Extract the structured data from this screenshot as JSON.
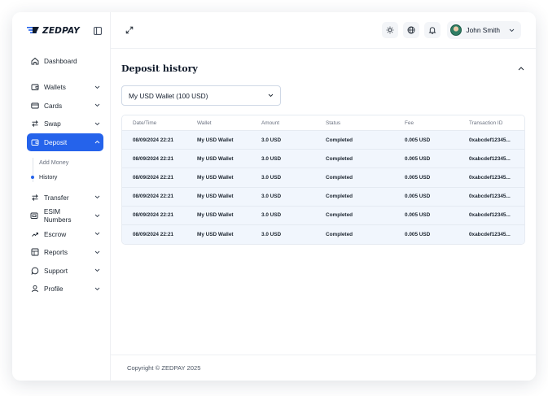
{
  "brand": {
    "name": "ZEDPAY"
  },
  "sidebar": {
    "items": [
      {
        "label": "Dashboard",
        "icon": "home-icon",
        "has_chevron": false
      },
      {
        "label": "Wallets",
        "icon": "wallet-icon",
        "has_chevron": true
      },
      {
        "label": "Cards",
        "icon": "card-icon",
        "has_chevron": true
      },
      {
        "label": "Swap",
        "icon": "swap-icon",
        "has_chevron": true
      },
      {
        "label": "Deposit",
        "icon": "deposit-icon",
        "has_chevron": true,
        "active": true,
        "children": [
          {
            "label": "Add Money"
          },
          {
            "label": "History",
            "current": true
          }
        ]
      },
      {
        "label": "Transfer",
        "icon": "transfer-icon",
        "has_chevron": true
      },
      {
        "label": "ESIM Numbers",
        "icon": "sim-icon",
        "has_chevron": true
      },
      {
        "label": "Escrow",
        "icon": "escrow-icon",
        "has_chevron": true
      },
      {
        "label": "Reports",
        "icon": "reports-icon",
        "has_chevron": true
      },
      {
        "label": "Support",
        "icon": "support-icon",
        "has_chevron": true
      },
      {
        "label": "Profile",
        "icon": "profile-icon",
        "has_chevron": true
      }
    ]
  },
  "header": {
    "user_name": "John Smith",
    "icons": [
      "expand-icon",
      "theme-toggle-icon",
      "language-globe-icon",
      "notification-bell-icon"
    ]
  },
  "section": {
    "title": "Deposit history",
    "wallet_select": {
      "value": "My USD Wallet (100 USD)"
    }
  },
  "table": {
    "columns": [
      "Date/Time",
      "Wallet",
      "Amount",
      "Status",
      "Fee",
      "Transaction ID"
    ],
    "rows": [
      [
        "08/09/2024 22:21",
        "My USD Wallet",
        "3.0 USD",
        "Completed",
        "0.005 USD",
        "0xabcdef12345..."
      ],
      [
        "08/09/2024 22:21",
        "My USD Wallet",
        "3.0 USD",
        "Completed",
        "0.005 USD",
        "0xabcdef12345..."
      ],
      [
        "08/09/2024 22:21",
        "My USD Wallet",
        "3.0 USD",
        "Completed",
        "0.005 USD",
        "0xabcdef12345..."
      ],
      [
        "08/09/2024 22:21",
        "My USD Wallet",
        "3.0 USD",
        "Completed",
        "0.005 USD",
        "0xabcdef12345..."
      ],
      [
        "08/09/2024 22:21",
        "My USD Wallet",
        "3.0 USD",
        "Completed",
        "0.005 USD",
        "0xabcdef12345..."
      ],
      [
        "08/09/2024 22:21",
        "My USD Wallet",
        "3.0 USD",
        "Completed",
        "0.005 USD",
        "0xabcdef12345..."
      ]
    ]
  },
  "footer": {
    "copyright": "Copyright © ZEDPAY 2025"
  },
  "colors": {
    "accent": "#2563eb",
    "row_bg": "#f1f6fd",
    "text": "#1c2530",
    "muted": "#6b7280"
  }
}
